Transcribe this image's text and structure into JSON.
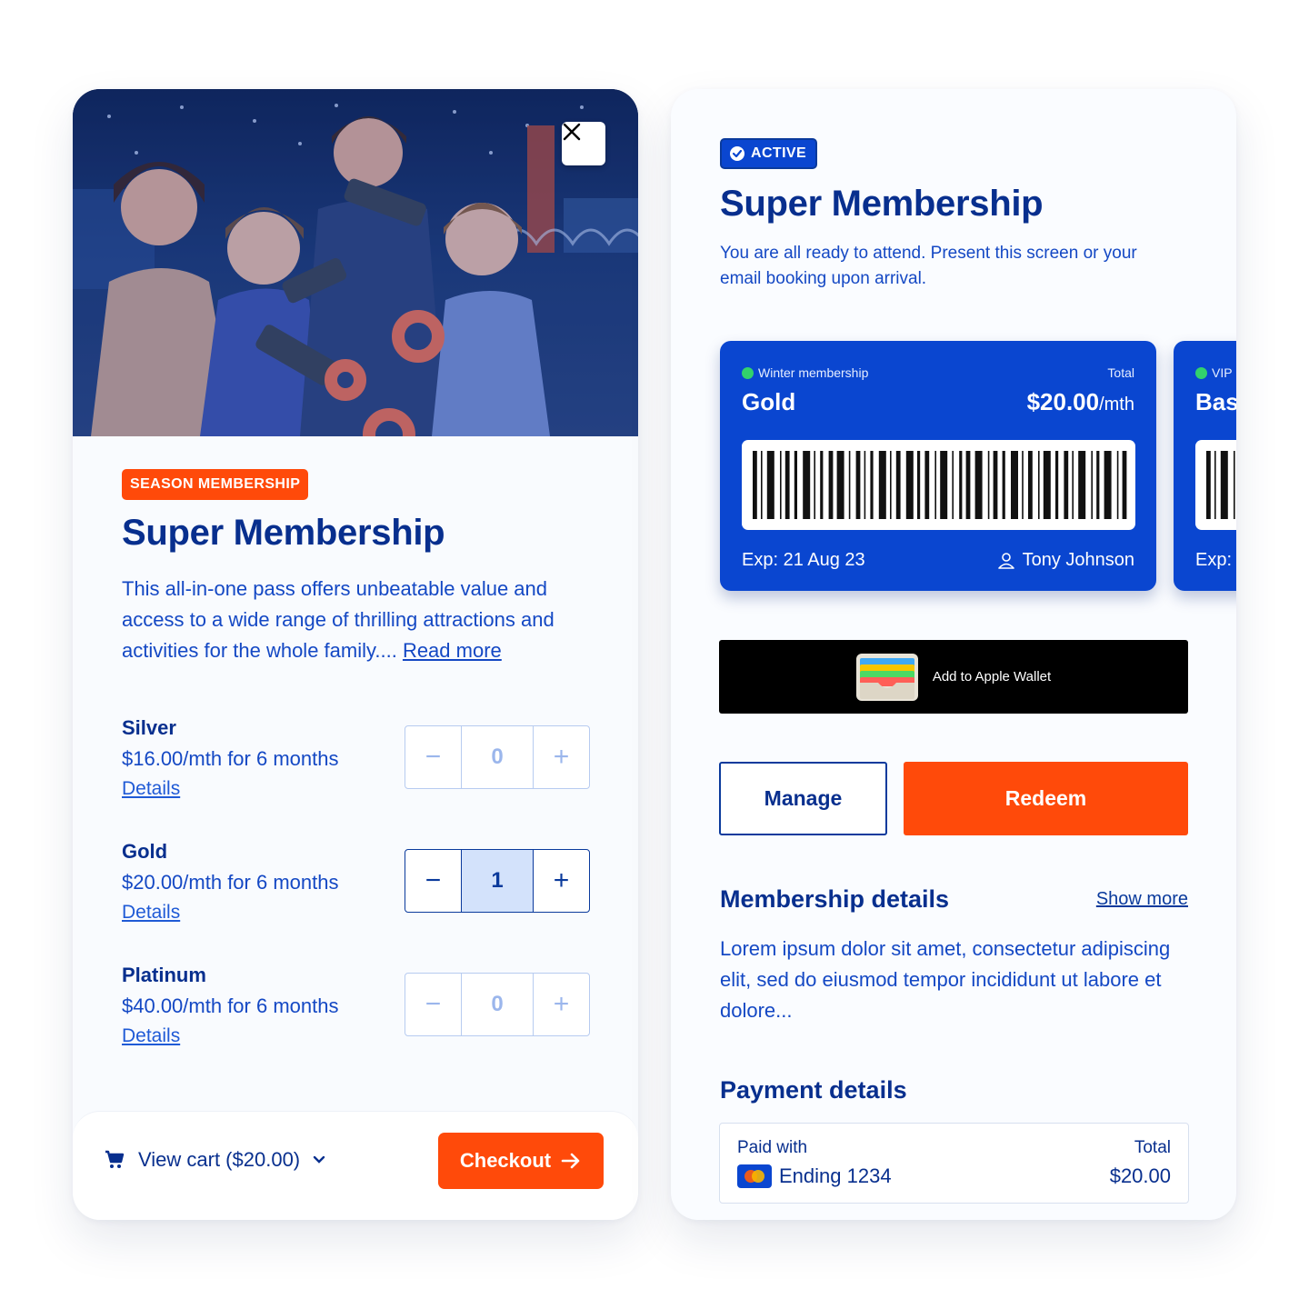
{
  "purchase": {
    "badge": "SEASON MEMBERSHIP",
    "title": "Super Membership",
    "description": "This all-in-one pass offers unbeatable value and access to a wide range of thrilling attractions and activities for the whole family....",
    "read_more": "Read more",
    "tiers": [
      {
        "name": "Silver",
        "price": "$16.00/mth for 6 months",
        "details": "Details",
        "quantity": "0",
        "active": false
      },
      {
        "name": "Gold",
        "price": "$20.00/mth for 6 months",
        "details": "Details",
        "quantity": "1",
        "active": true
      },
      {
        "name": "Platinum",
        "price": "$40.00/mth for 6 months",
        "details": "Details",
        "quantity": "0",
        "active": false
      }
    ],
    "stepper": {
      "minus": "−",
      "plus": "+"
    },
    "cart": {
      "label": "View cart ($20.00)"
    },
    "checkout": "Checkout"
  },
  "membership": {
    "status_badge": "ACTIVE",
    "title": "Super Membership",
    "description": "You are all ready to attend. Present this screen or your email booking upon arrival.",
    "cards": [
      {
        "type": "Winter membership",
        "tier": "Gold",
        "total_label": "Total",
        "total_amount": "$20.00",
        "total_unit": "/mth",
        "expiry": "Exp: 21 Aug 23",
        "holder": "Tony Johnson"
      },
      {
        "type": "VIP",
        "tier": "Bas",
        "expiry": "Exp:"
      }
    ],
    "wallet_button": "Add to Apple Wallet",
    "manage_button": "Manage",
    "redeem_button": "Redeem",
    "details_heading": "Membership details",
    "show_more": "Show more",
    "details_text": "Lorem ipsum dolor sit amet, consectetur adipiscing elit, sed do eiusmod tempor incididunt ut labore et dolore...",
    "payment_heading": "Payment details",
    "payment": {
      "paid_with_label": "Paid with",
      "card": "Ending 1234",
      "total_label": "Total",
      "total_amount": "$20.00"
    }
  },
  "colors": {
    "brand_blue": "#0a46d0",
    "navy": "#082f8e",
    "accent_orange": "#ff4a0a",
    "status_green": "#32d26c"
  }
}
